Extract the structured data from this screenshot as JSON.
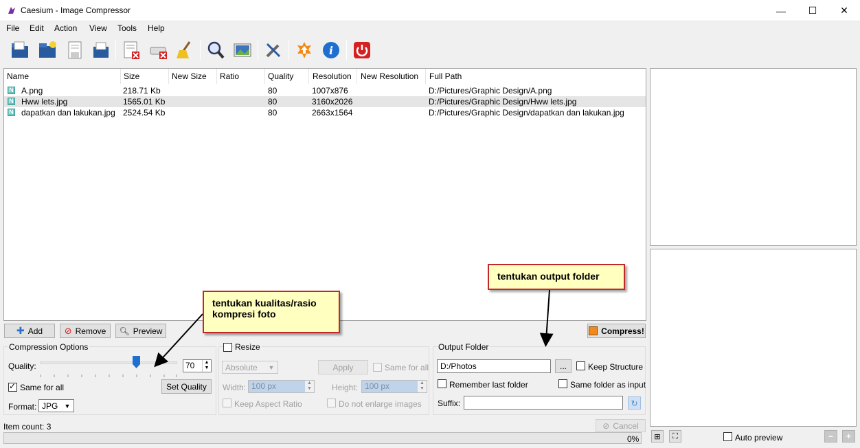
{
  "window": {
    "title": "Caesium - Image Compressor",
    "controls": {
      "minimize": "—",
      "maximize": "☐",
      "close": "✕"
    }
  },
  "menu": [
    "File",
    "Edit",
    "Action",
    "View",
    "Tools",
    "Help"
  ],
  "toolbar": [
    {
      "name": "open-files-icon"
    },
    {
      "name": "open-folder-icon"
    },
    {
      "name": "save-list-icon"
    },
    {
      "name": "export-icon"
    },
    {
      "name": "remove-items-icon"
    },
    {
      "name": "clear-list-icon"
    },
    {
      "name": "clean-icon"
    },
    {
      "name": "search-icon"
    },
    {
      "name": "image-preview-icon"
    },
    {
      "name": "settings-icon"
    },
    {
      "name": "update-icon"
    },
    {
      "name": "info-icon"
    },
    {
      "name": "power-icon"
    }
  ],
  "table": {
    "columns": [
      "Name",
      "Size",
      "New Size",
      "Ratio",
      "Quality",
      "Resolution",
      "New Resolution",
      "Full Path"
    ],
    "rows": [
      {
        "name": "A.png",
        "size": "218.71 Kb",
        "new_size": "",
        "ratio": "",
        "quality": "80",
        "resolution": "1007x876",
        "new_resolution": "",
        "path": "D:/Pictures/Graphic Design/A.png",
        "selected": false
      },
      {
        "name": "Hww lets.jpg",
        "size": "1565.01 Kb",
        "new_size": "",
        "ratio": "",
        "quality": "80",
        "resolution": "3160x2026",
        "new_resolution": "",
        "path": "D:/Pictures/Graphic Design/Hww lets.jpg",
        "selected": true
      },
      {
        "name": "dapatkan dan lakukan.jpg",
        "size": "2524.54 Kb",
        "new_size": "",
        "ratio": "",
        "quality": "80",
        "resolution": "2663x1564",
        "new_resolution": "",
        "path": "D:/Pictures/Graphic Design/dapatkan dan lakukan.jpg",
        "selected": false
      }
    ],
    "file_icon_letter": "N"
  },
  "actions": {
    "add": "Add",
    "remove": "Remove",
    "preview": "Preview",
    "compress": "Compress!"
  },
  "compression": {
    "title": "Compression Options",
    "quality_label": "Quality:",
    "quality_value": "70",
    "quality_level": 0.7,
    "same_for_all": "Same for all",
    "set_quality": "Set Quality",
    "format_label": "Format:",
    "format_value": "JPG"
  },
  "resize": {
    "title": "Resize",
    "mode": "Absolute",
    "apply": "Apply",
    "same_for_all": "Same for all",
    "width_label": "Width:",
    "width_value": "100 px",
    "height_label": "Height:",
    "height_value": "100 px",
    "keep_aspect": "Keep Aspect Ratio",
    "no_enlarge": "Do not enlarge images"
  },
  "output": {
    "title": "Output Folder",
    "folder": "D:/Photos",
    "browse": "...",
    "keep_structure": "Keep Structure",
    "remember_last": "Remember last folder",
    "same_folder": "Same folder as input",
    "suffix_label": "Suffix:",
    "suffix_value": ""
  },
  "status": {
    "item_count": "Item count: 3",
    "cancel": "Cancel",
    "progress": "0%"
  },
  "preview_panel": {
    "auto_preview": "Auto preview"
  },
  "callouts": {
    "quality": "tentukan kualitas/rasio kompresi foto",
    "output": "tentukan output folder"
  },
  "colors": {
    "accent": "#1f6fd1",
    "callout_border": "#c0282a",
    "callout_bg": "#ffffc0",
    "selection": "#e5e5e5"
  }
}
